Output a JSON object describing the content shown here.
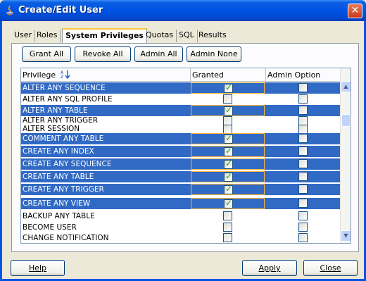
{
  "window": {
    "title": "Create/Edit User",
    "icon": "java-app-icon",
    "close": "✕"
  },
  "tabs": [
    {
      "label": "User",
      "active": false
    },
    {
      "label": "Roles",
      "active": false
    },
    {
      "label": "System Privileges",
      "active": true
    },
    {
      "label": "Quotas",
      "active": false
    },
    {
      "label": "SQL",
      "active": false
    },
    {
      "label": "Results",
      "active": false
    }
  ],
  "toolbar": {
    "grant_all": "Grant All",
    "revoke_all": "Revoke All",
    "admin_all": "Admin All",
    "admin_none": "Admin None"
  },
  "grid": {
    "headers": {
      "privilege": "Privilege",
      "granted": "Granted",
      "admin": "Admin Option"
    },
    "rows": [
      {
        "name": "ALTER ANY SEQUENCE",
        "selected": true,
        "granted": true,
        "admin": false
      },
      {
        "name": "ALTER ANY SQL PROFILE",
        "selected": false,
        "granted": false,
        "admin": false
      },
      {
        "name": "ALTER ANY TABLE",
        "selected": true,
        "granted": true,
        "admin": false
      },
      {
        "name": "ALTER ANY TRIGGER",
        "selected": false,
        "granted": false,
        "admin": false
      },
      {
        "name": "ALTER SESSION",
        "selected": false,
        "granted": false,
        "admin": false
      },
      {
        "name": "COMMENT ANY TABLE",
        "selected": true,
        "granted": true,
        "admin": false
      },
      {
        "name": "CREATE ANY INDEX",
        "selected": true,
        "granted": true,
        "admin": false
      },
      {
        "name": "CREATE ANY SEQUENCE",
        "selected": true,
        "granted": true,
        "admin": false
      },
      {
        "name": "CREATE ANY TABLE",
        "selected": true,
        "granted": true,
        "admin": false
      },
      {
        "name": "CREATE ANY TRIGGER",
        "selected": true,
        "granted": true,
        "admin": false
      },
      {
        "name": "CREATE ANY VIEW",
        "selected": true,
        "granted": true,
        "admin": false
      },
      {
        "name": "BACKUP ANY TABLE",
        "selected": false,
        "granted": false,
        "admin": false
      },
      {
        "name": "BECOME USER",
        "selected": false,
        "granted": false,
        "admin": false
      },
      {
        "name": "CHANGE NOTIFICATION",
        "selected": false,
        "granted": false,
        "admin": false
      }
    ]
  },
  "buttons": {
    "help": "Help",
    "apply": "Apply",
    "close": "Close"
  }
}
